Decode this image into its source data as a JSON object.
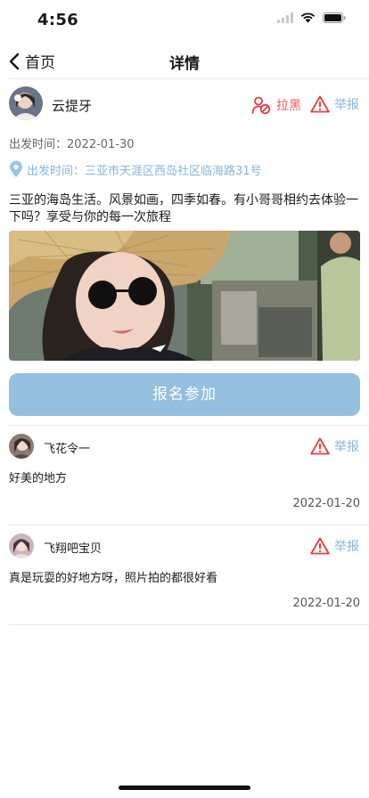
{
  "status": {
    "time": "4:56"
  },
  "nav": {
    "back_label": "首页",
    "title": "详情"
  },
  "post": {
    "username": "云提牙",
    "block_label": "拉黑",
    "report_label": "举报",
    "departure_label": "出发时间：",
    "departure_date": "2022-01-30",
    "location_text": "出发时间：三亚市天涯区西岛社区临海路31号",
    "description": "三亚的海岛生活。风景如画，四季如春。有小哥哥相约去体验一下吗？享受与你的每一次旅程",
    "join_label": "报名参加"
  },
  "comments": [
    {
      "name": "飞花令一",
      "text": "好美的地方",
      "date": "2022-01-20",
      "report_label": "举报"
    },
    {
      "name": "飞翔吧宝贝",
      "text": "真是玩耍的好地方呀，照片拍的都很好看",
      "date": "2022-01-20",
      "report_label": "举报"
    }
  ],
  "colors": {
    "accent": "#86b4d9",
    "button": "#93c0de",
    "danger": "#e83b3b"
  }
}
